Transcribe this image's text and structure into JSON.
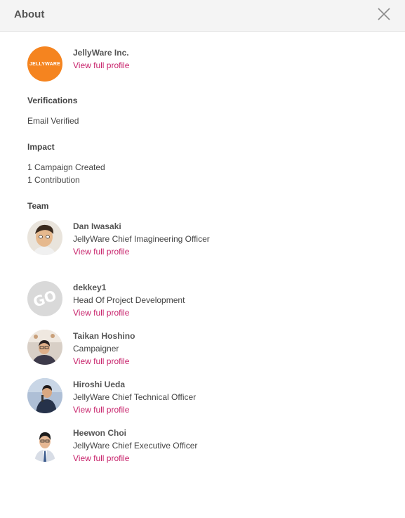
{
  "header": {
    "title": "About",
    "close_icon": "close-icon"
  },
  "organization": {
    "logo_text": "JELLYWARE",
    "name": "JellyWare Inc.",
    "profile_link": "View full profile",
    "brand_color": "#f5841f"
  },
  "verifications": {
    "title": "Verifications",
    "items": [
      "Email Verified"
    ]
  },
  "impact": {
    "title": "Impact",
    "items": [
      "1 Campaign Created",
      "1 Contribution"
    ]
  },
  "team": {
    "title": "Team",
    "members": [
      {
        "name": "Dan Iwasaki",
        "role": "JellyWare Chief Imagineering Officer",
        "link": "View full profile"
      },
      {
        "name": "dekkey1",
        "role": "Head Of Project Development",
        "link": "View full profile",
        "avatar_text": "GO"
      },
      {
        "name": "Taikan Hoshino",
        "role": "Campaigner",
        "link": "View full profile"
      },
      {
        "name": "Hiroshi Ueda",
        "role": "JellyWare Chief Technical Officer",
        "link": "View full profile"
      },
      {
        "name": "Heewon Choi",
        "role": "JellyWare Chief Executive Officer",
        "link": "View full profile"
      }
    ]
  },
  "colors": {
    "link": "#c7216a",
    "header_bg": "#f4f4f4"
  }
}
